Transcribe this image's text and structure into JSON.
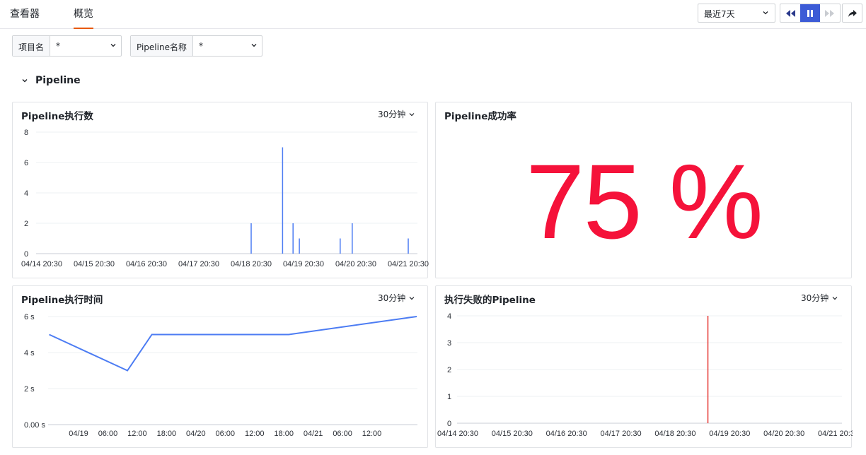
{
  "tabs": [
    {
      "label": "查看器",
      "active": false
    },
    {
      "label": "概览",
      "active": true
    }
  ],
  "time_range": {
    "selected": "最近7天"
  },
  "filters": [
    {
      "label": "项目名",
      "value": "*"
    },
    {
      "label": "Pipeline名称",
      "value": "*"
    }
  ],
  "section": {
    "title": "Pipeline",
    "expanded": true
  },
  "colors": {
    "accent_tab": "#e8590c",
    "bar_blue": "#4c7cf3",
    "line_blue": "#4c7cf3",
    "fail_red": "#e53935",
    "stat_red": "#f5123a",
    "pause_blue": "#3c5bd6"
  },
  "panels": {
    "exec_count": {
      "title": "Pipeline执行数",
      "interval": "30分钟"
    },
    "success_rate": {
      "title": "Pipeline成功率",
      "value": "75 %"
    },
    "exec_time": {
      "title": "Pipeline执行时间",
      "interval": "30分钟"
    },
    "failed": {
      "title": "执行失败的Pipeline",
      "interval": "30分钟"
    }
  },
  "chart_data": [
    {
      "id": "exec_count",
      "type": "bar",
      "y_ticks": [
        "0",
        "2",
        "4",
        "6",
        "8"
      ],
      "ylim": [
        0,
        8
      ],
      "x_tick_labels": [
        "04/14 20:30",
        "04/15 20:30",
        "04/16 20:30",
        "04/17 20:30",
        "04/18 20:30",
        "04/19 20:30",
        "04/20 20:30",
        "04/21 20:30"
      ],
      "x_range_days": [
        0,
        7
      ],
      "points": [
        {
          "day": 4.0,
          "value": 2
        },
        {
          "day": 4.6,
          "value": 7
        },
        {
          "day": 4.8,
          "value": 2
        },
        {
          "day": 4.92,
          "value": 1
        },
        {
          "day": 5.7,
          "value": 1
        },
        {
          "day": 5.93,
          "value": 2
        },
        {
          "day": 7.0,
          "value": 1
        }
      ]
    },
    {
      "id": "exec_time",
      "type": "line",
      "y_ticks": [
        "0.00 s",
        "2 s",
        "4 s",
        "6 s"
      ],
      "ylim": [
        0,
        6
      ],
      "x_tick_labels": [
        "04/19",
        "06:00",
        "12:00",
        "18:00",
        "04/20",
        "06:00",
        "12:00",
        "18:00",
        "04/21",
        "06:00",
        "12:00"
      ],
      "x_range_hours": [
        -10,
        72
      ],
      "series": [
        {
          "values": [
            {
              "hour": -6,
              "value": 5
            },
            {
              "hour": 10,
              "value": 3
            },
            {
              "hour": 15,
              "value": 5
            },
            {
              "hour": 43,
              "value": 5
            },
            {
              "hour": 74,
              "value": 6
            }
          ]
        }
      ]
    },
    {
      "id": "failed",
      "type": "bar",
      "y_ticks": [
        "0",
        "1",
        "2",
        "3",
        "4"
      ],
      "ylim": [
        0,
        4
      ],
      "x_tick_labels": [
        "04/14 20:30",
        "04/15 20:30",
        "04/16 20:30",
        "04/17 20:30",
        "04/18 20:30",
        "04/19 20:30",
        "04/20 20:30",
        "04/21 20:30"
      ],
      "x_range_days": [
        0,
        7
      ],
      "points": [
        {
          "day": 4.6,
          "value": 4
        }
      ]
    }
  ]
}
